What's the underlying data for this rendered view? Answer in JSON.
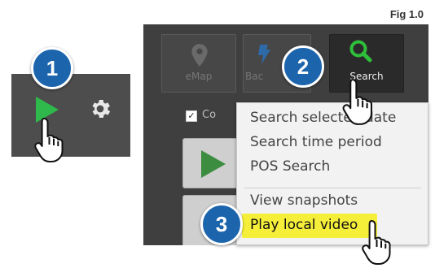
{
  "figure": {
    "label": "Fig 1.0"
  },
  "steps": {
    "one": "1",
    "two": "2",
    "three": "3"
  },
  "toolbar": {
    "emap_label": "eMap",
    "back_label": "Bac",
    "search_label": "Search"
  },
  "options": {
    "checkbox_label": "Co",
    "checkbox_mark": "✓"
  },
  "menu": {
    "items": [
      "Search selected date",
      "Search time period",
      "POS Search",
      "View snapshots"
    ],
    "highlighted": "Play local video"
  },
  "colors": {
    "step_blue": "#1c65ad",
    "play_green": "#2fb84b",
    "search_green": "#2fbf3a",
    "highlight_yellow": "#f6ef3a",
    "panel_dark": "#3f3f3f"
  },
  "icons": [
    "play-icon",
    "gear-icon",
    "map-pin-icon",
    "backup-icon",
    "magnifier-icon",
    "hand-pointer-icon"
  ]
}
